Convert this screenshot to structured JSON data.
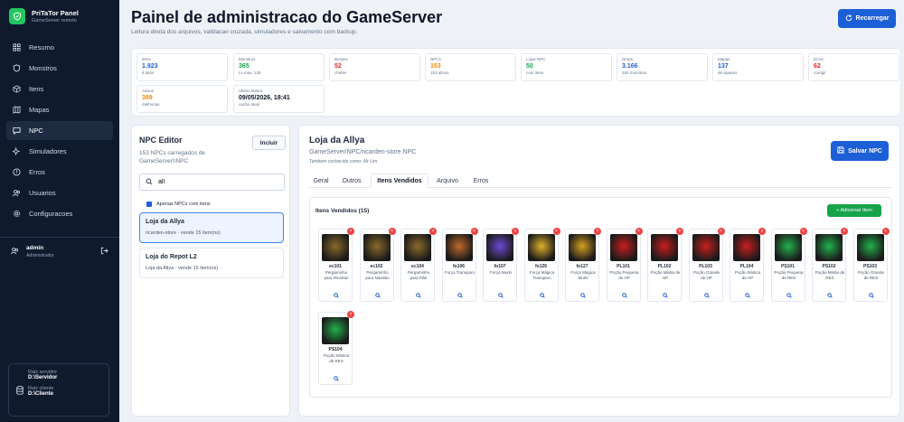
{
  "brand": {
    "title": "PriTaTor Panel",
    "subtitle": "GameServer remoto"
  },
  "nav": [
    {
      "label": "Resumo",
      "icon": "grid-icon"
    },
    {
      "label": "Monstros",
      "icon": "shield-icon"
    },
    {
      "label": "Itens",
      "icon": "box-icon"
    },
    {
      "label": "Mapas",
      "icon": "map-icon"
    },
    {
      "label": "NPC",
      "icon": "chat-icon",
      "active": true
    },
    {
      "label": "Simuladores",
      "icon": "sparkles-icon"
    },
    {
      "label": "Erros",
      "icon": "alert-icon"
    },
    {
      "label": "Usuarios",
      "icon": "users-icon"
    },
    {
      "label": "Configuracoes",
      "icon": "gear-icon"
    }
  ],
  "user": {
    "name": "admin",
    "role": "Administrador"
  },
  "paths": {
    "server_label": "Raiz servidor",
    "server_value": "D:\\Servidor",
    "client_label": "Raiz cliente",
    "client_value": "D:\\Cliente"
  },
  "header": {
    "title": "Painel de administracao do GameServer",
    "subtitle": "Leitura direta dos arquivos, validacao cruzada, simuladores e salvamento com backup.",
    "reload_label": "Recarregar"
  },
  "stats": [
    {
      "label": "Itens",
      "value": "1.923",
      "hint": "8 tipos",
      "color": "#1d5fd6"
    },
    {
      "label": "Monstros",
      "value": "365",
      "hint": "Lv max: 130",
      "color": "#16a34a"
    },
    {
      "label": "Bosses",
      "value": "52",
      "hint": "chefes",
      "color": "#dc2626"
    },
    {
      "label": "NPCs",
      "value": "153",
      "hint": "153 ativos",
      "color": "#ea8a0a"
    },
    {
      "label": "Lojas NPC",
      "value": "50",
      "hint": "com itens",
      "color": "#16a34a"
    },
    {
      "label": "Drops",
      "value": "3.166",
      "hint": "325 monstros",
      "color": "#1d5fd6"
    },
    {
      "label": "Mapas",
      "value": "137",
      "hint": "86 spawns",
      "color": "#1d5fd6"
    },
    {
      "label": "Erros",
      "value": "62",
      "hint": "corrigir",
      "color": "#dc2626"
    },
    {
      "label": "Avisos",
      "value": "389",
      "hint": "melhorias",
      "color": "#ea8a0a"
    },
    {
      "label": "Ultima leitura",
      "value": "09/05/2026, 18:41",
      "hint": "cache atual",
      "color": "#0f172a"
    }
  ],
  "editor": {
    "title": "NPC Editor",
    "subtitle": "153 NPCs carregados de GameServer\\\\NPC",
    "include_label": "Incluir",
    "search_value": "all",
    "filter_label": "Apenas NPCs com itens",
    "npcs": [
      {
        "name": "Loja da Allya",
        "detail": "ricarden-store · vende 15 item(ns)",
        "selected": true
      },
      {
        "name": "Loja do Repot L2",
        "detail": "Loja da Allya · vende 15 item(ns)",
        "selected": false
      }
    ]
  },
  "shop": {
    "title": "Loja da Allya",
    "path": "GameServer/NPC/ricarden-store.NPC",
    "alias": "Tambem conhecido como: Mr Lim",
    "save_label": "Salvar NPC",
    "tabs": [
      "Geral",
      "Outros",
      "Itens Vendidos",
      "Arquivo",
      "Erros"
    ],
    "active_tab": "Itens Vendidos",
    "items_title": "Itens Vendidos (15)",
    "add_label": "+ Adicionar Item",
    "items": [
      {
        "code": "ec101",
        "name": "Pergaminho para Ricartan",
        "color": "#8a6a2a"
      },
      {
        "code": "ec102",
        "name": "Pergaminho para Navisko",
        "color": "#8a6a2a"
      },
      {
        "code": "ec104",
        "name": "Pergaminho para Pilai",
        "color": "#8a6a2a"
      },
      {
        "code": "fo106",
        "name": "Força Transparo",
        "color": "#c0692a"
      },
      {
        "code": "fo107",
        "name": "Força Murki",
        "color": "#6d4bd6"
      },
      {
        "code": "fo126",
        "name": "Força Mágica Transparo",
        "color": "#e0b12a"
      },
      {
        "code": "fo127",
        "name": "Força Mágica Murki",
        "color": "#d4a020"
      },
      {
        "code": "PL101",
        "name": "Poção Pequena de HP",
        "color": "#c81e1e"
      },
      {
        "code": "PL102",
        "name": "Poção Média de HP",
        "color": "#c81e1e"
      },
      {
        "code": "PL103",
        "name": "Poção Grande de HP",
        "color": "#c81e1e"
      },
      {
        "code": "PL104",
        "name": "Poção Mística de HP",
        "color": "#c81e1e"
      },
      {
        "code": "PS101",
        "name": "Poção Pequena de RES",
        "color": "#22b14c"
      },
      {
        "code": "PS102",
        "name": "Poção Média de RES",
        "color": "#22b14c"
      },
      {
        "code": "PS103",
        "name": "Poção Grande de RES",
        "color": "#22b14c"
      },
      {
        "code": "PS104",
        "name": "Poção Mística de RES",
        "color": "#22b14c"
      }
    ]
  }
}
